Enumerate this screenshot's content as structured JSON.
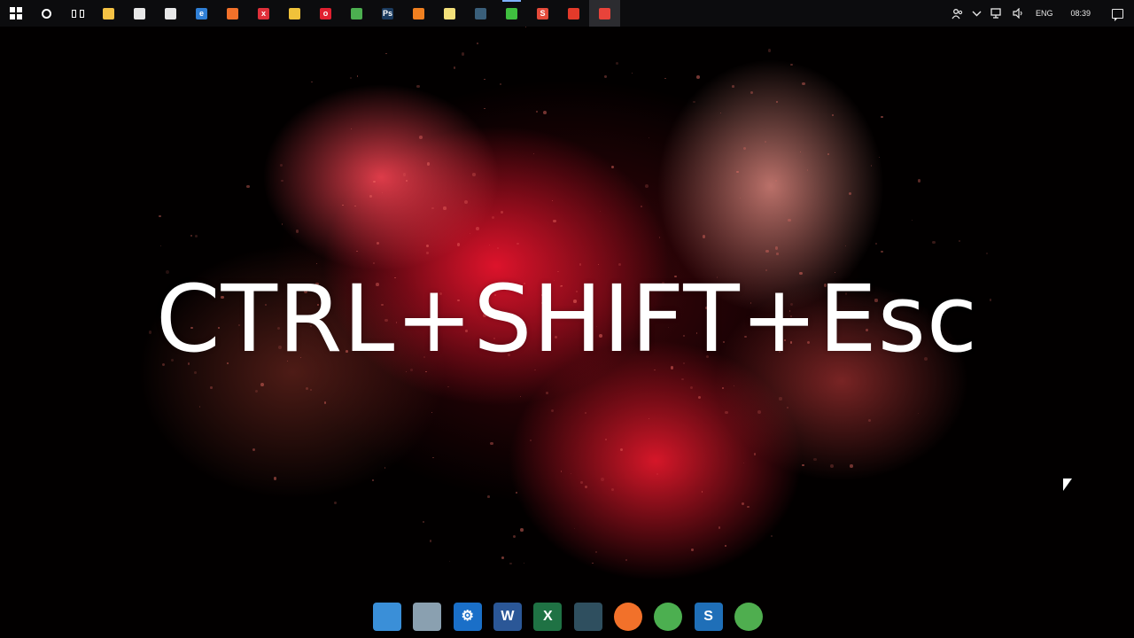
{
  "wallpaper": {
    "text": "CTRL+SHIFT+Esc"
  },
  "taskbar": {
    "start": {
      "icon": "windows-logo-icon"
    },
    "search": {
      "icon": "cortana-icon"
    },
    "task_view": {
      "icon": "task-view-icon"
    },
    "pinned": [
      {
        "name": "file-explorer-icon",
        "color": "#f5c244",
        "glyph": ""
      },
      {
        "name": "store-icon",
        "color": "#e8e8e8",
        "glyph": ""
      },
      {
        "name": "mail-icon",
        "color": "#e8e8e8",
        "glyph": ""
      },
      {
        "name": "edge-icon",
        "color": "#2f7fd6",
        "glyph": "e"
      },
      {
        "name": "firefox-icon",
        "color": "#f2712a",
        "glyph": ""
      },
      {
        "name": "red-x-app-icon",
        "color": "#e0303a",
        "glyph": "x"
      },
      {
        "name": "yellow-app-icon",
        "color": "#f0c23a",
        "glyph": ""
      },
      {
        "name": "opera-icon",
        "color": "#e02030",
        "glyph": "o"
      },
      {
        "name": "chrome-icon",
        "color": "#4caf50",
        "glyph": ""
      },
      {
        "name": "photoshop-icon",
        "color": "#1b3b5f",
        "glyph": "Ps"
      },
      {
        "name": "vlc-icon",
        "color": "#f08020",
        "glyph": ""
      },
      {
        "name": "sticky-notes-icon",
        "color": "#f3e07a",
        "glyph": ""
      },
      {
        "name": "media-app-icon",
        "color": "#3a5f7a",
        "glyph": ""
      },
      {
        "name": "camtasia-icon",
        "color": "#3fbf3f",
        "glyph": ""
      },
      {
        "name": "snagit-icon",
        "color": "#e44a3a",
        "glyph": "S"
      },
      {
        "name": "red-record-icon",
        "color": "#e33a2a",
        "glyph": ""
      },
      {
        "name": "screen-recorder-icon",
        "color": "#e8433a",
        "glyph": ""
      }
    ],
    "tray": {
      "people": "people-icon",
      "chevron": "chevron-up-icon",
      "network": "network-icon",
      "volume": "volume-icon",
      "language": "ENG",
      "time": "08:39",
      "notifications": "notification-icon"
    }
  },
  "dock": {
    "items": [
      {
        "name": "dock-this-pc-icon",
        "color": "#3a8fd8",
        "glyph": ""
      },
      {
        "name": "dock-recycle-bin-icon",
        "color": "#8aa0b0",
        "glyph": ""
      },
      {
        "name": "dock-settings-icon",
        "color": "#1a6fc8",
        "glyph": "⚙"
      },
      {
        "name": "dock-word-icon",
        "color": "#2b5797",
        "glyph": "W"
      },
      {
        "name": "dock-excel-icon",
        "color": "#1f7244",
        "glyph": "X"
      },
      {
        "name": "dock-media-app-icon",
        "color": "#2f4f5f",
        "glyph": ""
      },
      {
        "name": "dock-firefox-icon",
        "color": "#f2712a",
        "glyph": ""
      },
      {
        "name": "dock-chrome-icon",
        "color": "#4caf50",
        "glyph": ""
      },
      {
        "name": "dock-snagit-icon",
        "color": "#1f6fb8",
        "glyph": "S"
      },
      {
        "name": "dock-internet-download-icon",
        "color": "#4fae4f",
        "glyph": ""
      }
    ]
  },
  "cursor": {
    "icon": "mouse-pointer-icon"
  }
}
